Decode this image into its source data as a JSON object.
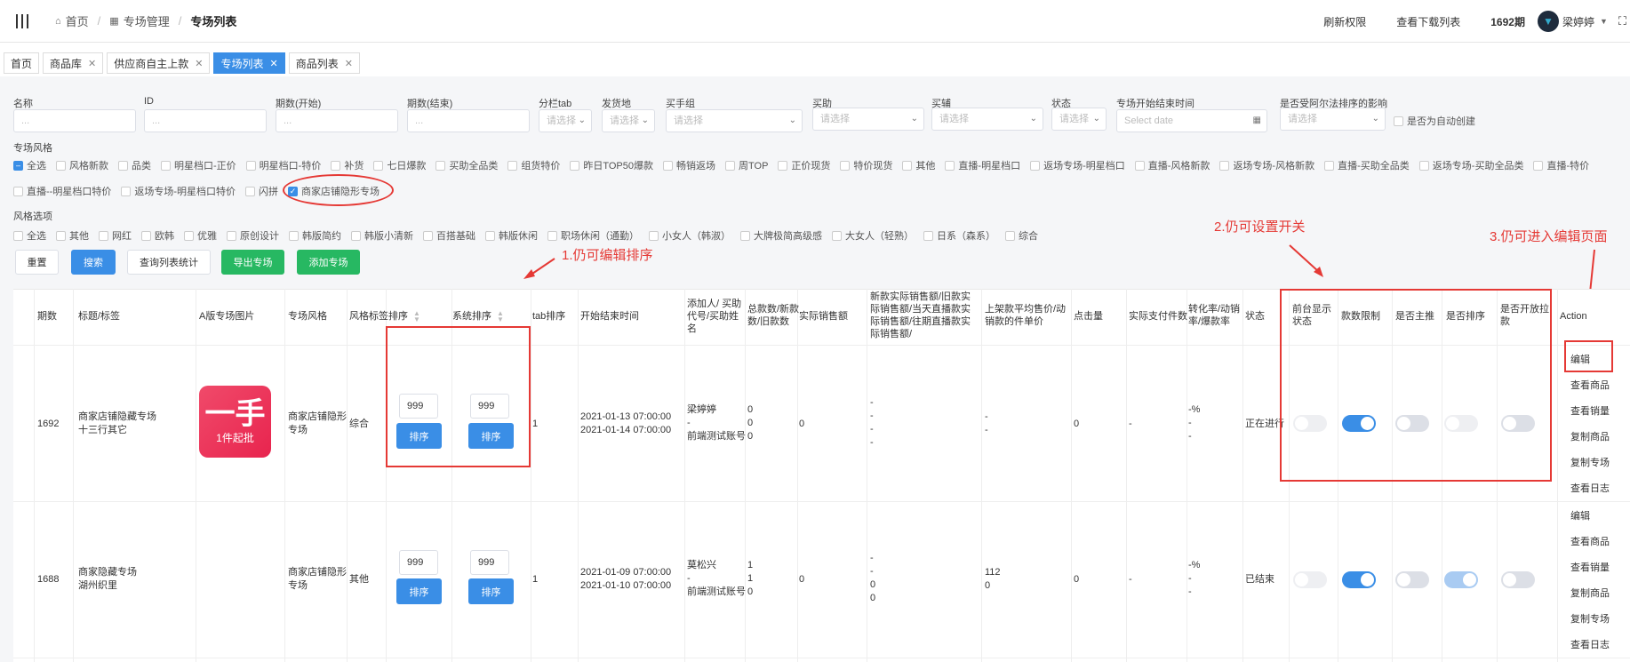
{
  "topbar": {
    "breadcrumb": [
      "首页",
      "专场管理",
      "专场列表"
    ],
    "right_links": [
      "刷新权限",
      "查看下载列表",
      "1692期"
    ],
    "user_name": "梁婷婷"
  },
  "tabs": [
    {
      "label": "首页",
      "closable": false,
      "active": false
    },
    {
      "label": "商品库",
      "closable": true,
      "active": false
    },
    {
      "label": "供应商自主上款",
      "closable": true,
      "active": false
    },
    {
      "label": "专场列表",
      "closable": true,
      "active": true
    },
    {
      "label": "商品列表",
      "closable": true,
      "active": false
    }
  ],
  "filters": {
    "name": {
      "label": "名称",
      "placeholder": "..."
    },
    "id": {
      "label": "ID",
      "placeholder": "..."
    },
    "period_start": {
      "label": "期数(开始)",
      "placeholder": "..."
    },
    "period_end": {
      "label": "期数(结束)",
      "placeholder": "..."
    },
    "tab": {
      "label": "分栏tab",
      "placeholder": "请选择"
    },
    "ship_from": {
      "label": "发货地",
      "placeholder": "请选择"
    },
    "buyer_group": {
      "label": "买手组",
      "placeholder": "请选择"
    },
    "buyer_help": {
      "label": "买助",
      "placeholder": "请选择"
    },
    "buyer_assist": {
      "label": "买辅",
      "placeholder": "请选择"
    },
    "status": {
      "label": "状态",
      "placeholder": "请选择"
    },
    "time": {
      "label": "专场开始结束时间",
      "placeholder": "Select date"
    },
    "alpha": {
      "label": "是否受阿尔法排序的影响",
      "placeholder": "请选择"
    },
    "auto_create": "是否为自动创建"
  },
  "style_section": {
    "label": "专场风格",
    "row1": [
      "全选",
      "风格新款",
      "品类",
      "明星档口-正价",
      "明星档口-特价",
      "补货",
      "七日爆款",
      "买助全品类",
      "组货特价",
      "昨日TOP50爆款",
      "畅销返场",
      "周TOP",
      "正价现货",
      "特价现货",
      "其他",
      "直播-明星档口",
      "返场专场-明星档口",
      "直播-风格新款",
      "返场专场-风格新款",
      "直播-买助全品类",
      "返场专场-买助全品类",
      "直播-特价"
    ],
    "row2": [
      "直播--明星档口特价",
      "返场专场-明星档口特价",
      "闪拼",
      "商家店铺隐形专场"
    ]
  },
  "style_options": {
    "label": "风格选项",
    "items": [
      "全选",
      "其他",
      "网红",
      "欧韩",
      "优雅",
      "原创设计",
      "韩版简约",
      "韩版小清新",
      "百搭基础",
      "韩版休闲",
      "职场休闲（通勤）",
      "小女人（韩淑）",
      "大牌极简高级感",
      "大女人（轻熟）",
      "日系（森系）",
      "综合"
    ]
  },
  "buttons": {
    "reset": "重置",
    "search": "搜索",
    "stats": "查询列表统计",
    "export": "导出专场",
    "add": "添加专场"
  },
  "annotations": {
    "a1": "1.仍可编辑排序",
    "a2": "2.仍可设置开关",
    "a3": "3.仍可进入编辑页面"
  },
  "columns": {
    "period": "期数",
    "title": "标题/标签",
    "image": "A版专场图片",
    "style": "专场风格",
    "style_tag": "风格标签",
    "sort": "排序",
    "sys_sort": "系统排序",
    "tab_sort": "tab排序",
    "time": "开始结束时间",
    "adder": "添加人/ 买助代号/买助姓名",
    "counts": "总款数/新款数/旧款数",
    "sales": "实际销售额",
    "sales_detail": "新款实际销售额/旧款实际销售额/当天直播款实际销售额/往期直播款实际销售额/",
    "avg_price": "上架款平均售价/动销款的件单价",
    "clicks": "点击量",
    "paid": "实际支付件数",
    "conv": "转化率/动销率/爆款率",
    "status": "状态",
    "front": "前台显示状态",
    "limit": "款数限制",
    "main": "是否主推",
    "is_sort": "是否排序",
    "pull": "是否开放拉款",
    "action": "Action"
  },
  "rows": [
    {
      "period": "1692",
      "title1": "商家店铺隐藏专场",
      "title2": "十三行其它",
      "logo_big": "一手",
      "logo_small": "1件起批",
      "style1": "商家店铺隐形",
      "style2": "专场",
      "style_tag": "综合",
      "sort": "999",
      "sys_sort": "999",
      "sort_btn": "排序",
      "tab_sort": "1",
      "start": "2021-01-13 07:00:00",
      "end": "2021-01-14 07:00:00",
      "adder1": "梁婷婷",
      "adder2": "-",
      "adder3": "前端测试账号",
      "counts": [
        "0",
        "0",
        "0"
      ],
      "sales": "0",
      "sales_detail": [
        "-",
        "-",
        "-",
        "-"
      ],
      "avg_price": [
        "-",
        "-"
      ],
      "clicks": "0",
      "paid": "-",
      "conv": [
        "-%",
        "-",
        "-"
      ],
      "status": "正在进行",
      "toggles": {
        "front": false,
        "limit": true,
        "main": false,
        "is_sort": false,
        "pull": false
      },
      "actions": [
        "编辑",
        "查看商品",
        "查看销量",
        "复制商品",
        "复制专场",
        "查看日志"
      ]
    },
    {
      "period": "1688",
      "title1": "商家隐藏专场",
      "title2": "湖州织里",
      "style1": "商家店铺隐形",
      "style2": "专场",
      "style_tag": "其他",
      "sort": "999",
      "sys_sort": "999",
      "sort_btn": "排序",
      "tab_sort": "1",
      "start": "2021-01-09 07:00:00",
      "end": "2021-01-10 07:00:00",
      "adder1": "莫松兴",
      "adder2": "-",
      "adder3": "前端测试账号",
      "counts": [
        "1",
        "1",
        "0"
      ],
      "sales": "0",
      "sales_detail": [
        "-",
        "-",
        "0",
        "0"
      ],
      "avg_price": [
        "112",
        "0"
      ],
      "clicks": "0",
      "paid": "-",
      "conv": [
        "-%",
        "-",
        "-"
      ],
      "status": "已结束",
      "toggles": {
        "front": false,
        "limit": true,
        "main": false,
        "is_sort": true,
        "pull": false
      },
      "actions": [
        "编辑",
        "查看商品",
        "查看销量",
        "复制商品",
        "复制专场",
        "查看日志"
      ]
    }
  ],
  "colors": {
    "primary": "#3a8ee6",
    "success": "#27b862",
    "annotation": "#e53935"
  }
}
